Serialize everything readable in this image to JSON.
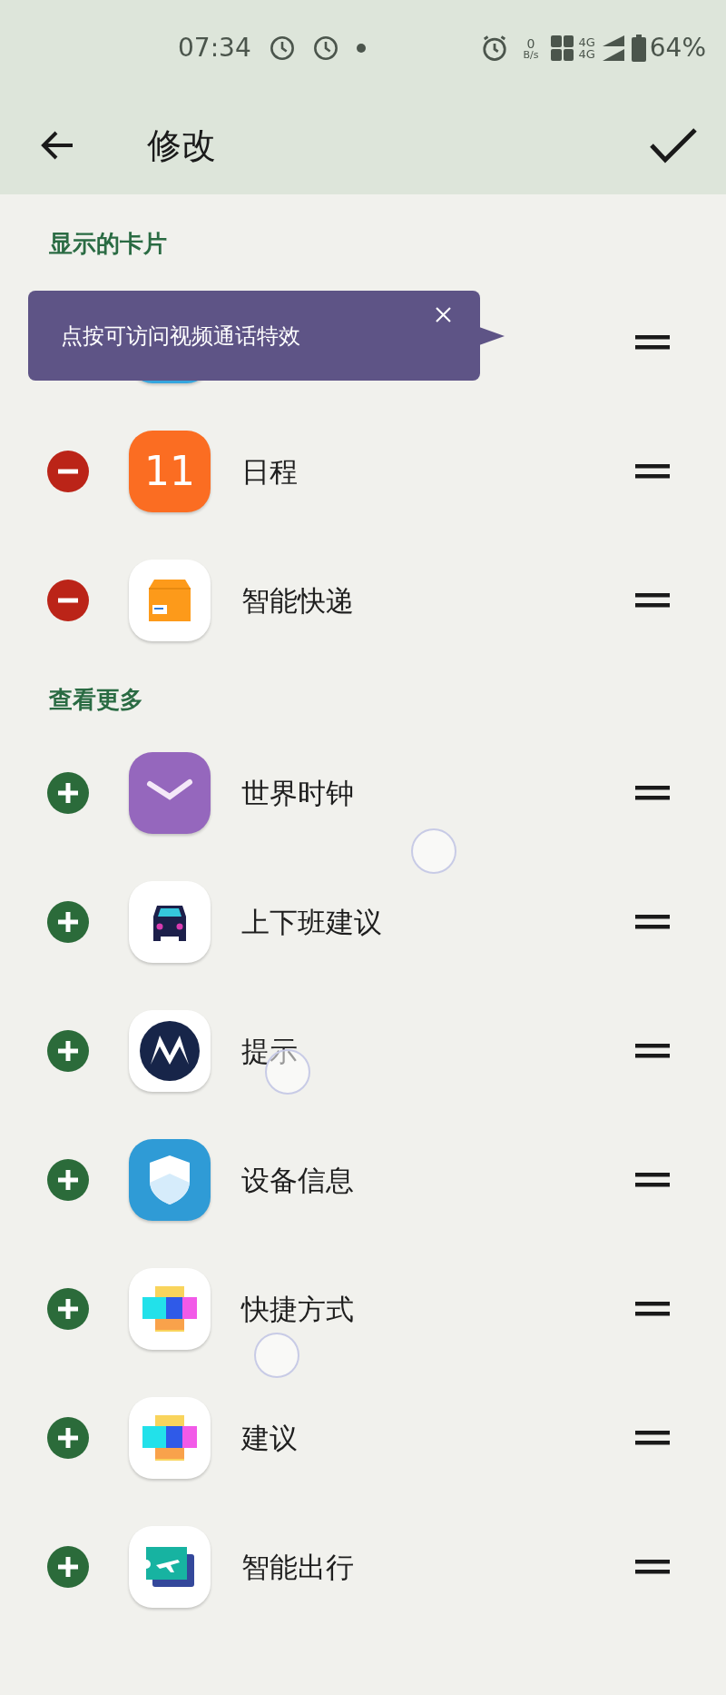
{
  "status_bar": {
    "time": "07:34",
    "net_speed_value": "0",
    "net_speed_unit": "B/s",
    "network_types": [
      "4G",
      "4G"
    ],
    "battery": "64%"
  },
  "app_bar": {
    "title": "修改"
  },
  "tooltip": {
    "text": "点按可访问视频通话特效"
  },
  "sections": [
    {
      "heading": "显示的卡片",
      "items": [
        {
          "kind": "covered"
        },
        {
          "kind": "removable",
          "label": "日程",
          "badge": "11"
        },
        {
          "kind": "removable",
          "label": "智能快递"
        }
      ]
    },
    {
      "heading": "查看更多",
      "items": [
        {
          "kind": "addable",
          "label": "世界时钟"
        },
        {
          "kind": "addable",
          "label": "上下班建议"
        },
        {
          "kind": "addable",
          "label": "提示"
        },
        {
          "kind": "addable",
          "label": "设备信息"
        },
        {
          "kind": "addable",
          "label": "快捷方式"
        },
        {
          "kind": "addable",
          "label": "建议"
        },
        {
          "kind": "addable",
          "label": "智能出行"
        }
      ]
    }
  ]
}
